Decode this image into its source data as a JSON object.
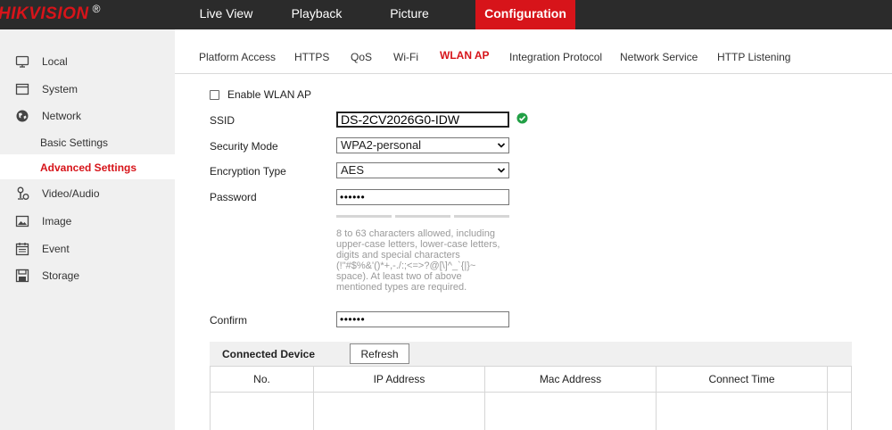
{
  "brand": {
    "name": "HIKVISION",
    "trademark": "®",
    "accent": "#d7141a"
  },
  "top_nav": [
    {
      "label": "Live View",
      "active": false
    },
    {
      "label": "Playback",
      "active": false
    },
    {
      "label": "Picture",
      "active": false
    },
    {
      "label": "Configuration",
      "active": true
    }
  ],
  "sidebar": {
    "items": [
      {
        "label": "Local",
        "icon": "monitor-icon"
      },
      {
        "label": "System",
        "icon": "system-icon"
      },
      {
        "label": "Network",
        "icon": "network-globe-icon"
      },
      {
        "label": "Video/Audio",
        "icon": "video-audio-icon"
      },
      {
        "label": "Image",
        "icon": "image-icon"
      },
      {
        "label": "Event",
        "icon": "event-calendar-icon"
      },
      {
        "label": "Storage",
        "icon": "storage-disk-icon"
      }
    ],
    "network_sub": [
      {
        "label": "Basic Settings",
        "active": false
      },
      {
        "label": "Advanced Settings",
        "active": true
      }
    ]
  },
  "tabs": [
    {
      "label": "Platform Access",
      "active": false
    },
    {
      "label": "HTTPS",
      "active": false
    },
    {
      "label": "QoS",
      "active": false
    },
    {
      "label": "Wi-Fi",
      "active": false
    },
    {
      "label": "WLAN AP",
      "active": true
    },
    {
      "label": "Integration Protocol",
      "active": false
    },
    {
      "label": "Network Service",
      "active": false
    },
    {
      "label": "HTTP Listening",
      "active": false
    }
  ],
  "form": {
    "enable_label": "Enable WLAN AP",
    "enable_checked": false,
    "ssid_label": "SSID",
    "ssid_value": "DS-2CV2026G0-IDW",
    "security_mode_label": "Security Mode",
    "security_mode_value": "WPA2-personal",
    "encryption_label": "Encryption Type",
    "encryption_value": "AES",
    "password_label": "Password",
    "password_value": "••••••",
    "password_hint": "8 to 63 characters allowed, including upper-case letters, lower-case letters, digits and special characters (!\"#$%&'()*+,-./:;<=>?@[\\]^_`{|}~ space). At least two of above mentioned types are required.",
    "confirm_label": "Confirm",
    "confirm_value": "••••••"
  },
  "connected_device": {
    "title": "Connected Device",
    "refresh_label": "Refresh",
    "columns": [
      "No.",
      "IP Address",
      "Mac Address",
      "Connect Time"
    ]
  }
}
